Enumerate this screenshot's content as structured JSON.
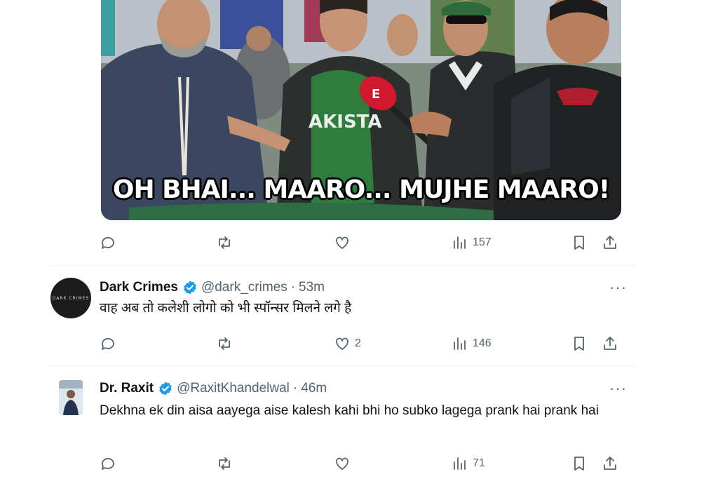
{
  "media": {
    "caption": "OH BHAI... MAARO... MUJHE MAARO!",
    "jersey_text": "AKISTA",
    "mic_logo": "E"
  },
  "tweets": [
    {
      "actions": {
        "reply": "",
        "retweet": "",
        "like": "",
        "views": "157"
      }
    },
    {
      "avatar_text": "DARK CRIMES",
      "name": "Dark Crimes",
      "handle": "@dark_crimes",
      "dot": "·",
      "time": "53m",
      "text": "वाह अब तो कलेशी लोगो को भी स्पॉन्सर मिलने लगे है",
      "actions": {
        "reply": "",
        "retweet": "",
        "like": "2",
        "views": "146"
      }
    },
    {
      "name": "Dr. Raxit",
      "handle": "@RaxitKhandelwal",
      "dot": "·",
      "time": "46m",
      "text": "Dekhna ek din aisa aayega aise kalesh kahi bhi ho subko lagega prank hai prank hai",
      "actions": {
        "reply": "",
        "retweet": "",
        "like": "",
        "views": "71"
      }
    }
  ],
  "more_label": "···",
  "colors": {
    "verified": "#1d9bf0",
    "secondary": "#536471",
    "divider": "#eff3f4",
    "jersey": "#2f7d3e"
  },
  "icons": [
    "reply-icon",
    "retweet-icon",
    "like-icon",
    "views-icon",
    "bookmark-icon",
    "share-icon",
    "verified-badge-icon",
    "more-icon"
  ]
}
